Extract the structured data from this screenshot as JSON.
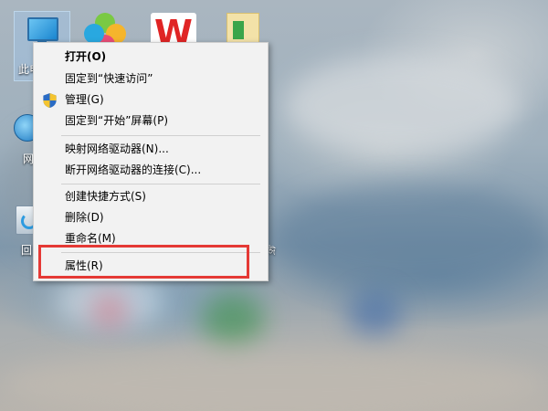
{
  "desktop": {
    "icons": [
      {
        "label": "此电",
        "icon": "this-pc-icon"
      },
      {
        "label": "",
        "icon": "clover-app-icon"
      },
      {
        "label": "",
        "icon": "wps-office-icon"
      },
      {
        "label": "",
        "icon": "folder-icon"
      },
      {
        "label": "网",
        "icon": "network-icon"
      },
      {
        "label": "回",
        "icon": "recycle-bin-icon"
      }
    ],
    "partial_right_label": "ঈ"
  },
  "context_menu": {
    "items": [
      {
        "label": "打开(O)",
        "bold": true
      },
      {
        "label": "固定到“快速访问”"
      },
      {
        "label": "管理(G)",
        "icon": "uac-shield-icon"
      },
      {
        "label": "固定到“开始”屏幕(P)"
      },
      {
        "label": "映射网络驱动器(N)..."
      },
      {
        "label": "断开网络驱动器的连接(C)..."
      },
      {
        "label": "创建快捷方式(S)"
      },
      {
        "label": "删除(D)"
      },
      {
        "label": "重命名(M)"
      },
      {
        "label": "属性(R)"
      }
    ]
  },
  "highlight": {
    "color": "#e53935",
    "target": "属性(R)"
  }
}
